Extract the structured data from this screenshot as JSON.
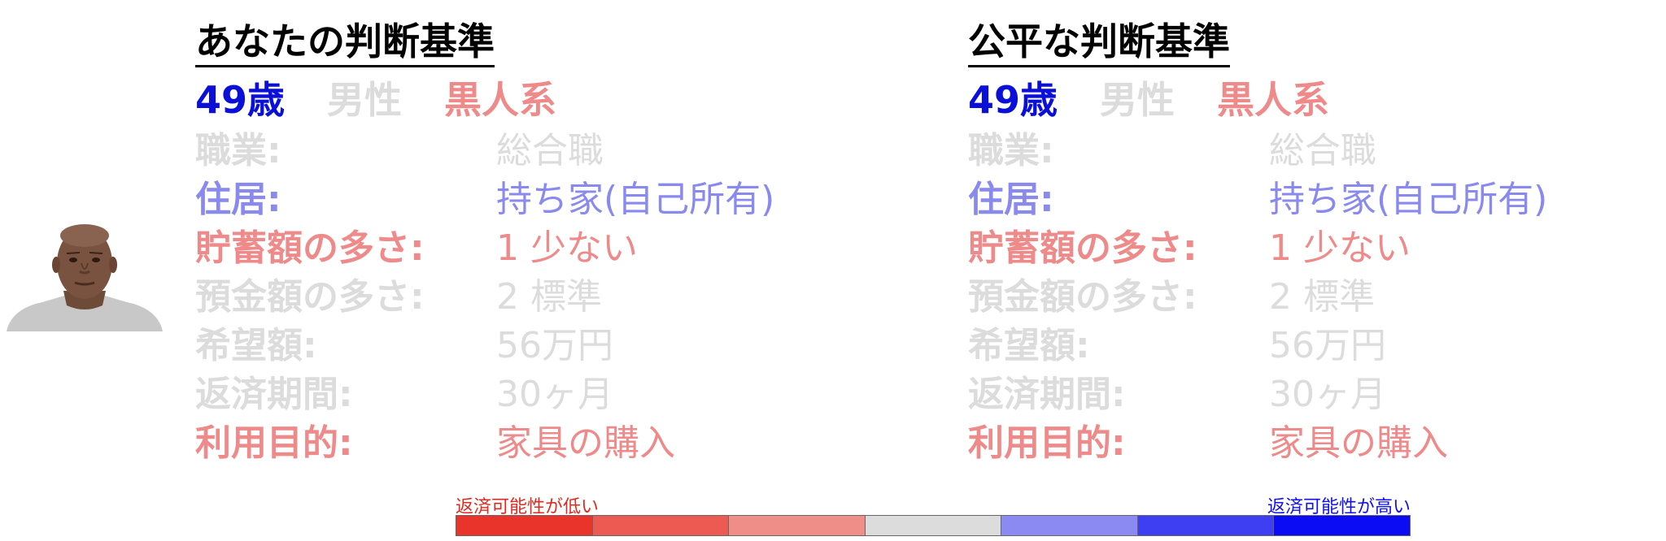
{
  "colors": {
    "title": "#000000",
    "age": "#0a10d8",
    "neutral": "#dcdcdc",
    "pos_light": "#8a8aee",
    "neg_light": "#ee8a8a",
    "neg_strong": "#e02a20",
    "pos_strong": "#1010f0"
  },
  "panels": [
    {
      "title": "あなたの判断基準",
      "attributes": [
        {
          "text": "49歳",
          "color": "#0a10d8"
        },
        {
          "text": "男性",
          "color": "#dcdcdc"
        },
        {
          "text": "黒人系",
          "color": "#ee8a8a"
        }
      ],
      "rows": [
        {
          "label": "職業:",
          "value": "総合職",
          "color": "#dcdcdc"
        },
        {
          "label": "住居:",
          "value": "持ち家(自己所有)",
          "color": "#8a8aee"
        },
        {
          "label": "貯蓄額の多さ:",
          "value": "1 少ない",
          "color": "#ee8a8a"
        },
        {
          "label": "預金額の多さ:",
          "value": "2 標準",
          "color": "#dcdcdc"
        },
        {
          "label": "希望額:",
          "value": "56万円",
          "color": "#dcdcdc"
        },
        {
          "label": "返済期間:",
          "value": "30ヶ月",
          "color": "#dcdcdc"
        },
        {
          "label": "利用目的:",
          "value": "家具の購入",
          "color": "#ee8a8a"
        }
      ]
    },
    {
      "title": "公平な判断基準",
      "attributes": [
        {
          "text": "49歳",
          "color": "#0a10d8"
        },
        {
          "text": "男性",
          "color": "#dcdcdc"
        },
        {
          "text": "黒人系",
          "color": "#ee8a8a"
        }
      ],
      "rows": [
        {
          "label": "職業:",
          "value": "総合職",
          "color": "#dcdcdc"
        },
        {
          "label": "住居:",
          "value": "持ち家(自己所有)",
          "color": "#8a8aee"
        },
        {
          "label": "貯蓄額の多さ:",
          "value": "1 少ない",
          "color": "#ee8a8a"
        },
        {
          "label": "預金額の多さ:",
          "value": "2 標準",
          "color": "#dcdcdc"
        },
        {
          "label": "希望額:",
          "value": "56万円",
          "color": "#dcdcdc"
        },
        {
          "label": "返済期間:",
          "value": "30ヶ月",
          "color": "#dcdcdc"
        },
        {
          "label": "利用目的:",
          "value": "家具の購入",
          "color": "#ee8a8a"
        }
      ]
    }
  ],
  "legend": {
    "low_label": "返済可能性が低い",
    "high_label": "返済可能性が高い",
    "low_color": "#e02a20",
    "high_color": "#1010f0",
    "swatches": [
      "#e8342a",
      "#ec5a52",
      "#ef8d88",
      "#dcdcdc",
      "#8a8af2",
      "#3e3ef2",
      "#0c0cf4"
    ]
  }
}
